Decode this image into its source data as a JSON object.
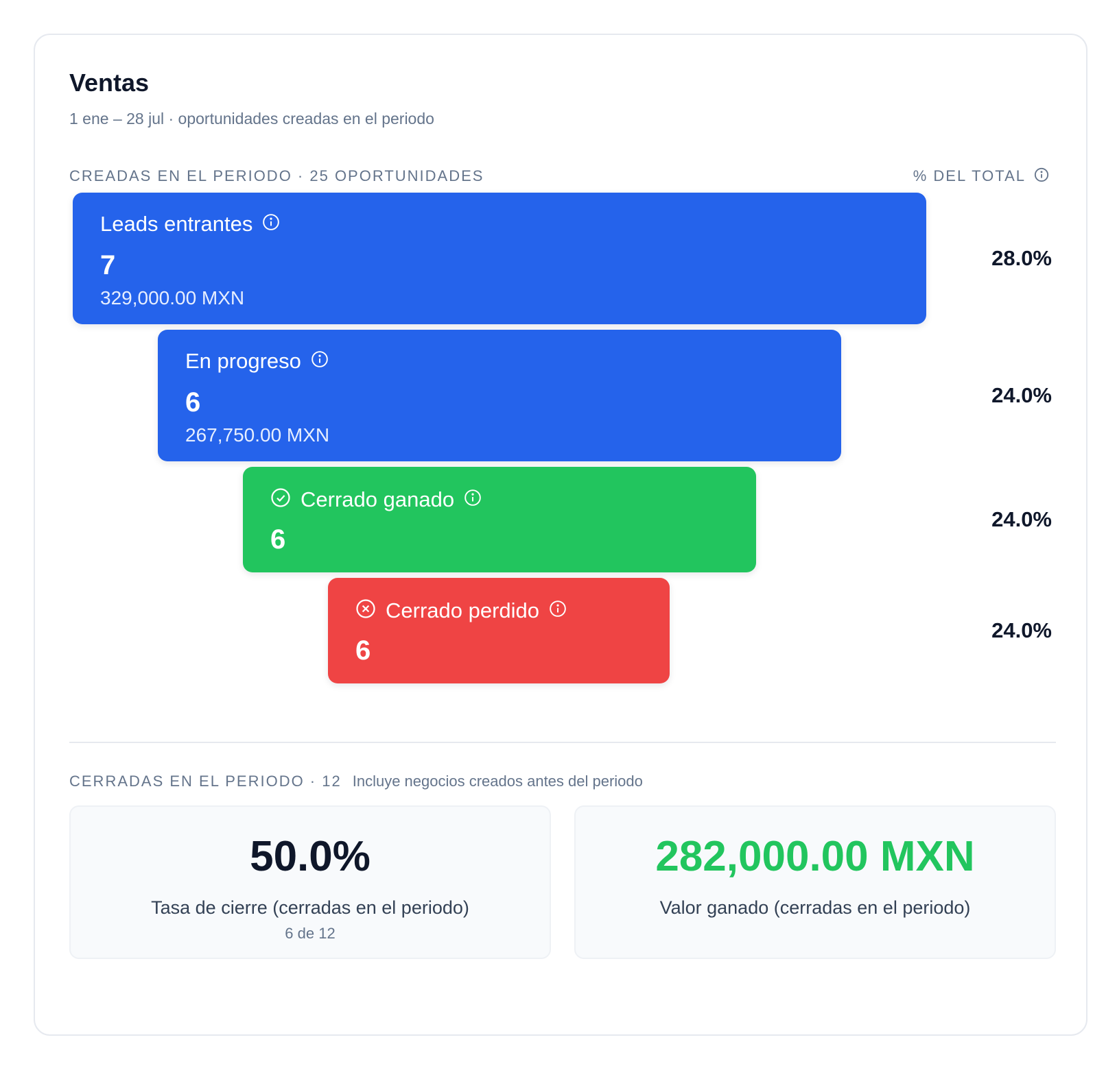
{
  "title": "Ventas",
  "subtitle": "1 ene – 28 jul · oportunidades creadas en el periodo",
  "created_section": {
    "label": "CREADAS EN EL PERIODO · 25 OPORTUNIDADES",
    "pct_header": "% DEL TOTAL"
  },
  "funnel": [
    {
      "label": "Leads entrantes",
      "count": "7",
      "amount": "329,000.00 MXN",
      "pct": "28.0%",
      "color": "#2563eb",
      "icon": "info-icon"
    },
    {
      "label": "En progreso",
      "count": "6",
      "amount": "267,750.00 MXN",
      "pct": "24.0%",
      "color": "#2563eb",
      "icon": "info-icon"
    },
    {
      "label": "Cerrado ganado",
      "count": "6",
      "pct": "24.0%",
      "color": "#22c55e",
      "icon": "check-circle-icon"
    },
    {
      "label": "Cerrado perdido",
      "count": "6",
      "pct": "24.0%",
      "color": "#ef4444",
      "icon": "x-circle-icon"
    }
  ],
  "closed_section": {
    "label": "CERRADAS EN EL PERIODO · 12",
    "note": "Incluye negocios creados antes del periodo"
  },
  "stats": {
    "close_rate": {
      "value": "50.0%",
      "caption": "Tasa de cierre (cerradas en el periodo)",
      "sub": "6 de 12",
      "color": "#0f172a"
    },
    "won_value": {
      "value": "282,000.00 MXN",
      "caption": "Valor ganado (cerradas en el periodo)",
      "color": "#22c55e"
    }
  }
}
